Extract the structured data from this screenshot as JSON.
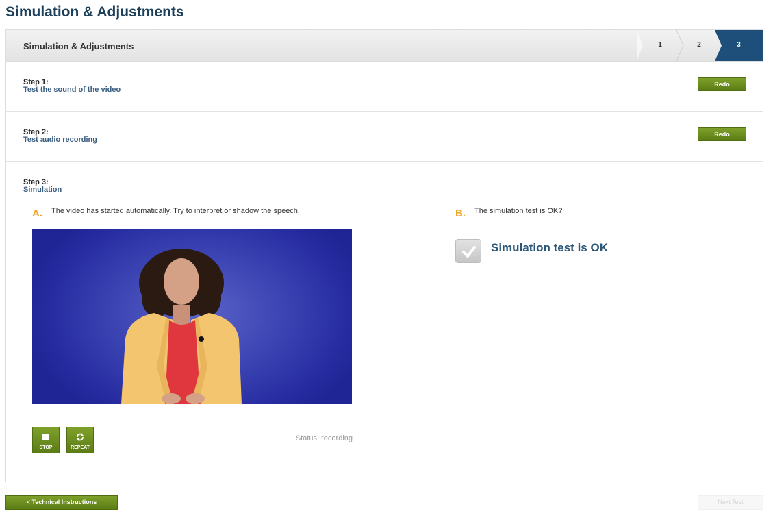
{
  "page": {
    "title": "Simulation & Adjustments"
  },
  "header": {
    "title": "Simulation & Adjustments",
    "steps": [
      "1",
      "2",
      "3"
    ],
    "active_step": 3,
    "active_color": "#1d4f7a"
  },
  "steps": [
    {
      "label": "Step 1:",
      "description": "Test the sound of the video",
      "button": "Redo"
    },
    {
      "label": "Step 2:",
      "description": "Test audio recording",
      "button": "Redo"
    },
    {
      "label": "Step 3:",
      "description": "Simulation"
    }
  ],
  "simulation": {
    "left": {
      "letter": "A.",
      "instruction": "The video has started automatically. Try to interpret or shadow the speech.",
      "controls": [
        {
          "label": "STOP",
          "icon": "stop-icon"
        },
        {
          "label": "REPEAT",
          "icon": "repeat-icon"
        }
      ],
      "status": "Status: recording"
    },
    "right": {
      "letter": "B.",
      "question": "The simulation test is OK?",
      "checkbox_label": "Simulation test is OK"
    }
  },
  "footer": {
    "back_button": "<   Technical Instructions",
    "next_button": "Next Test"
  },
  "colors": {
    "button_green": "#6b8c1f",
    "accent_orange": "#f0a32b",
    "title_blue": "#1c3f5a"
  }
}
